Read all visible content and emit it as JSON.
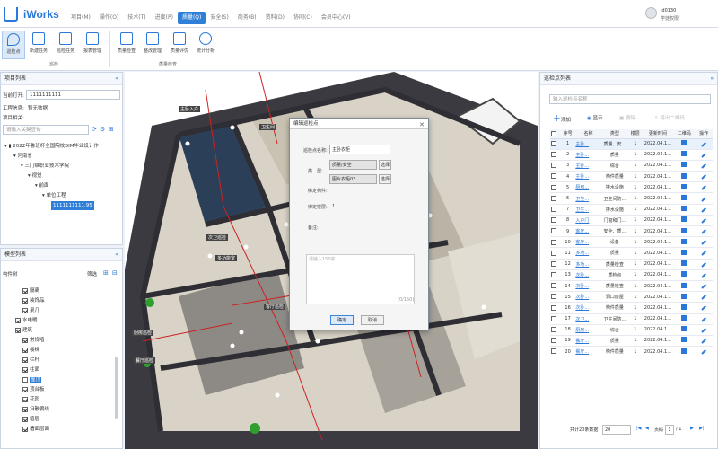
{
  "app": {
    "name": "iWorks"
  },
  "menu": [
    "项目(M)",
    "操作(O)",
    "技术(T)",
    "进度(P)",
    "质量(Q)",
    "安全(S)",
    "商务(B)",
    "资料(D)",
    "协同(C)",
    "会员中心(V)"
  ],
  "menu_active_index": 4,
  "user": {
    "name": "ld0130",
    "role": "学徒权限"
  },
  "ribbon": {
    "buttons": [
      "巡检点",
      "新建任务",
      "巡检任务",
      "报表管理",
      "质量检查",
      "整改管理",
      "质量评优",
      "统计分析"
    ],
    "groups": [
      "巡检",
      "质量检查"
    ]
  },
  "project_panel": {
    "title": "项目列表",
    "current_label": "当前打开:",
    "current_value": "1111111111",
    "engineering_label": "工程信息:",
    "engineering_value": "暂无数据",
    "project_label": "项目相关:",
    "search_placeholder": "请输入关键查询",
    "tree": [
      "2022年鲁班杯全国院校BIM毕业设计作",
      "河南省",
      "三门峡职业技术学院",
      "视觉",
      "前面",
      "单位工程",
      "1111111111.95"
    ]
  },
  "category_panel": {
    "title": "模型列表",
    "tree_label": "构件树",
    "filter_label": "筛选",
    "items": [
      "隔离",
      "装饰品",
      "桌几",
      "水电暖",
      "建筑",
      "常规墙",
      "楼梯",
      "栏杆",
      "柱面",
      "屋顶",
      "顶台板",
      "花园",
      "扫散偏线",
      "墙层",
      "墙面层面"
    ]
  },
  "dialog": {
    "title": "编辑巡检点",
    "name_label": "巡检点名称:",
    "name_value": "主卧衣柜",
    "type_label": "类　型:",
    "type_value": "质量/安全",
    "select1": "选择",
    "category_value": "图片衣柜03",
    "select2": "选择",
    "component_label": "绑定构件:",
    "count_label": "绑定楼层:",
    "count_value": "1",
    "remark_label": "备注:",
    "remark_placeholder": "请输入150字",
    "counter": "(0/150)",
    "ok": "确定",
    "cancel": "取消"
  },
  "inspect_panel": {
    "title": "巡检点列表",
    "search_placeholder": "输入巡检点名称",
    "toolbar": [
      "添加",
      "显示",
      "删除",
      "导出二维码"
    ],
    "headers": [
      "序号",
      "名称",
      "类型",
      "楼层",
      "更新时间",
      "二维码",
      "操作"
    ],
    "rows": [
      [
        "1",
        "主卧...",
        "质量、安...",
        "1",
        "2022.04.1..."
      ],
      [
        "2",
        "主卧...",
        "质量",
        "1",
        "2022.04.1..."
      ],
      [
        "3",
        "主卧...",
        "综合",
        "1",
        "2022.04.1..."
      ],
      [
        "4",
        "主卧...",
        "构件质量",
        "1",
        "2022.04.1..."
      ],
      [
        "5",
        "厨房...",
        "排水设施",
        "1",
        "2022.04.1..."
      ],
      [
        "6",
        "卫生...",
        "卫生间防...",
        "1",
        "2022.04.1..."
      ],
      [
        "7",
        "卫生...",
        "排水设施",
        "1",
        "2022.04.1..."
      ],
      [
        "8",
        "入户门",
        "门窗和门...",
        "1",
        "2022.04.1..."
      ],
      [
        "9",
        "客厅...",
        "安全、质...",
        "1",
        "2022.04.1..."
      ],
      [
        "10",
        "客厅...",
        "设备",
        "1",
        "2022.04.1..."
      ],
      [
        "11",
        "多功...",
        "质量",
        "1",
        "2022.04.1..."
      ],
      [
        "12",
        "多功...",
        "质量检查",
        "1",
        "2022.04.1..."
      ],
      [
        "13",
        "次卧...",
        "质检点",
        "1",
        "2022.04.1..."
      ],
      [
        "14",
        "次卧...",
        "质量检查",
        "1",
        "2022.04.1..."
      ],
      [
        "15",
        "次卧...",
        "洞口房屋",
        "1",
        "2022.04.1..."
      ],
      [
        "16",
        "次卧...",
        "构件质量",
        "1",
        "2022.04.1..."
      ],
      [
        "17",
        "次卫...",
        "卫生间防...",
        "1",
        "2022.04.1..."
      ],
      [
        "18",
        "厨房...",
        "综合",
        "1",
        "2022.04.1..."
      ],
      [
        "19",
        "餐厅...",
        "质量",
        "1",
        "2022.04.1..."
      ],
      [
        "20",
        "餐厅...",
        "构件质量",
        "1",
        "2022.04.1..."
      ]
    ],
    "footer": {
      "total": "共计20条数据",
      "page_size": "20",
      "page_label": "页码",
      "page": "1",
      "of": "/ 1"
    }
  },
  "viewport": {
    "label_1": "主卧衣柜",
    "label_2": "次卫巡检",
    "label_3": "多功能室",
    "label_4": "客厅巡检",
    "label_5": "厨房巡检",
    "label_6": "餐厅巡检",
    "label_7": "主卧入户",
    "label_8": "卫生间"
  },
  "colors": {
    "accent": "#2f7fd8",
    "wall": "#2e2e34",
    "floor": "#d9d4c8"
  }
}
